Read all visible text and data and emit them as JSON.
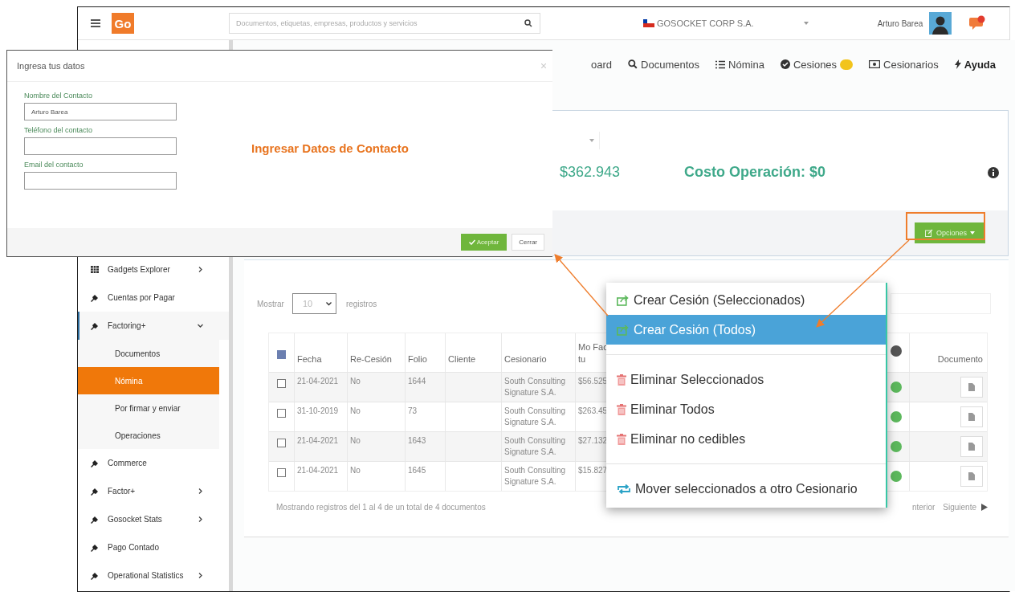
{
  "topbar": {
    "logo": "Go",
    "search": {
      "placeholder": "Documentos, etiquetas, empresas, productos y servicios"
    },
    "company": "GOSOCKET CORP S.A.",
    "user": "Arturo Barea"
  },
  "nav": [
    {
      "label": "oard",
      "has_badge": false,
      "emphasized": false
    },
    {
      "label": "Documentos",
      "has_badge": false,
      "emphasized": false
    },
    {
      "label": "Nómina",
      "has_badge": false,
      "emphasized": false
    },
    {
      "label": "Cesiones",
      "has_badge": true,
      "emphasized": false
    },
    {
      "label": "Cesionarios",
      "has_badge": false,
      "emphasized": false
    },
    {
      "label": "Ayuda",
      "has_badge": false,
      "emphasized": true
    }
  ],
  "sidebar": {
    "items": [
      {
        "label": "Gadgets Explorer",
        "expandable": true,
        "expanded": false
      },
      {
        "label": "Cuentas por Pagar",
        "expandable": false,
        "expanded": false
      },
      {
        "label": "Factoring+",
        "expandable": true,
        "expanded": true,
        "children": [
          {
            "label": "Documentos",
            "selected": false
          },
          {
            "label": "Nómina",
            "selected": true
          },
          {
            "label": "Por firmar y enviar",
            "selected": false
          },
          {
            "label": "Operaciones",
            "selected": false
          }
        ]
      },
      {
        "label": "Commerce",
        "expandable": false,
        "expanded": false
      },
      {
        "label": "Factor+",
        "expandable": true,
        "expanded": false
      },
      {
        "label": "Gosocket Stats",
        "expandable": true,
        "expanded": false
      },
      {
        "label": "Pago Contado",
        "expandable": false,
        "expanded": false
      },
      {
        "label": "Operational Statistics",
        "expandable": true,
        "expanded": false
      }
    ]
  },
  "summary": {
    "amount": "$362.943",
    "cost": "Costo Operación: $0",
    "options_button": "Opciones"
  },
  "table": {
    "show_label": "Mostrar",
    "page_size": "10",
    "records_label": "registros",
    "header_checked": true,
    "columns": [
      "Fecha",
      "Re-Cesión",
      "Folio",
      "Cliente",
      "Cesionario",
      "Mo Factu",
      "Documento"
    ],
    "rows": [
      {
        "checked": false,
        "fecha": "21-04-2021",
        "recesion": "No",
        "folio": "1644",
        "cesionario": "South Consulting Signature S.A.",
        "monto": "$56.525"
      },
      {
        "checked": false,
        "fecha": "31-10-2019",
        "recesion": "No",
        "folio": "73",
        "cesionario": "South Consulting Signature S.A.",
        "monto": "$263.45"
      },
      {
        "checked": false,
        "fecha": "21-04-2021",
        "recesion": "No",
        "folio": "1643",
        "cesionario": "South Consulting Signature S.A.",
        "monto": "$27.132"
      },
      {
        "checked": false,
        "fecha": "21-04-2021",
        "recesion": "No",
        "folio": "1645",
        "cesionario": "South Consulting Signature S.A.",
        "monto": "$15.827"
      }
    ],
    "info": "Mostrando registros del 1 al 4 de un total de 4 documentos",
    "prev": "nterior",
    "next": "Siguiente"
  },
  "modal": {
    "title": "Ingresa tus datos",
    "fields": [
      {
        "label": "Nombre del Contacto",
        "value": "Arturo Barea"
      },
      {
        "label": "Teléfono del contacto"
      },
      {
        "label": "Email del contacto"
      }
    ],
    "buttons": [
      {
        "label": "Aceptar",
        "primary": true
      },
      {
        "label": "Cerrar",
        "primary": false
      }
    ]
  },
  "annotation": "Ingresar Datos de Contacto",
  "menu": [
    {
      "kind": "create",
      "label": "Crear Cesión (Seleccionados)",
      "selected": false
    },
    {
      "kind": "create",
      "label": "Crear Cesión (Todos)",
      "selected": true
    },
    {
      "kind": "divider"
    },
    {
      "kind": "delete",
      "label": "Eliminar Seleccionados",
      "selected": false
    },
    {
      "kind": "delete",
      "label": "Eliminar Todos",
      "selected": false
    },
    {
      "kind": "delete",
      "label": "Eliminar no cedibles",
      "selected": false
    },
    {
      "kind": "divider"
    },
    {
      "kind": "move",
      "label": "Mover seleccionados a otro Cesionario",
      "selected": false
    }
  ]
}
